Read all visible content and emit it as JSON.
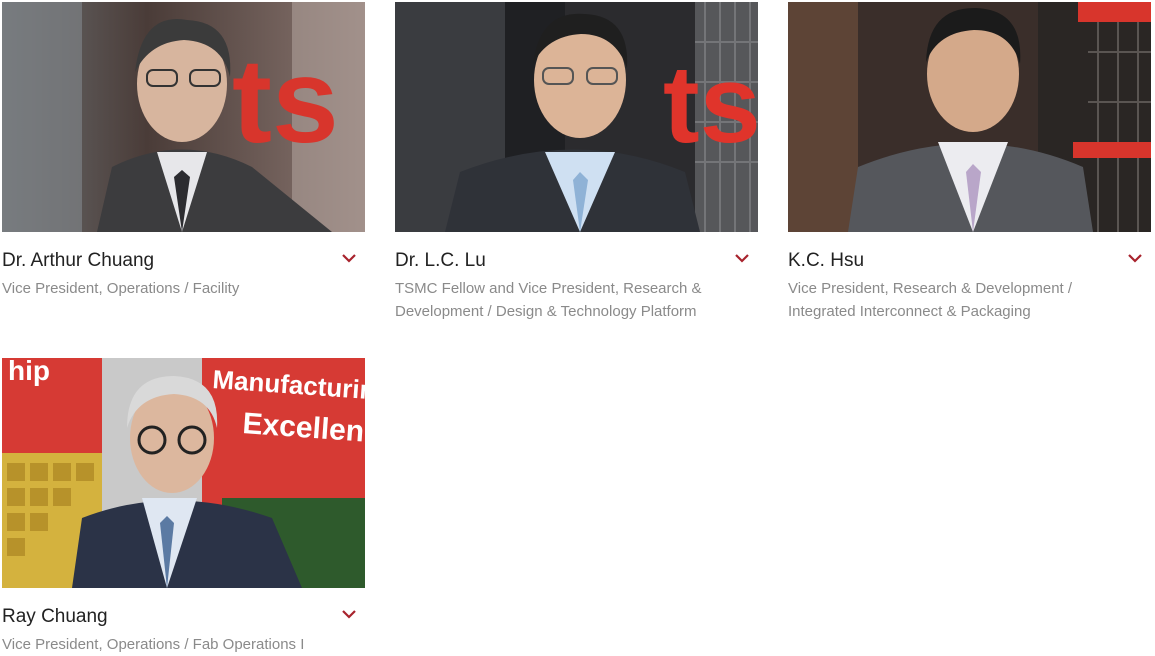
{
  "accent_color": "#a8232d",
  "people": [
    {
      "name": "Dr. Arthur Chuang",
      "title": "Vice President, Operations / Facility",
      "photo_alt": "Portrait of Dr. Arthur Chuang"
    },
    {
      "name": "Dr. L.C. Lu",
      "title": "TSMC Fellow and Vice President, Research & Development / Design & Technology Platform",
      "photo_alt": "Portrait of Dr. L.C. Lu"
    },
    {
      "name": "K.C. Hsu",
      "title": "Vice President, Research & Development / Integrated Interconnect & Packaging",
      "photo_alt": "Portrait of K.C. Hsu"
    },
    {
      "name": "Ray Chuang",
      "title": "Vice President, Operations / Fab Operations I",
      "photo_alt": "Portrait of Ray Chuang"
    }
  ],
  "photo_backdrop_text": {
    "logo_fragment": "ts",
    "banner_line_1": "Manufacturing",
    "banner_line_2": "Excellence",
    "banner_left": "hip"
  },
  "icons": {
    "expand": "chevron-down-icon"
  }
}
